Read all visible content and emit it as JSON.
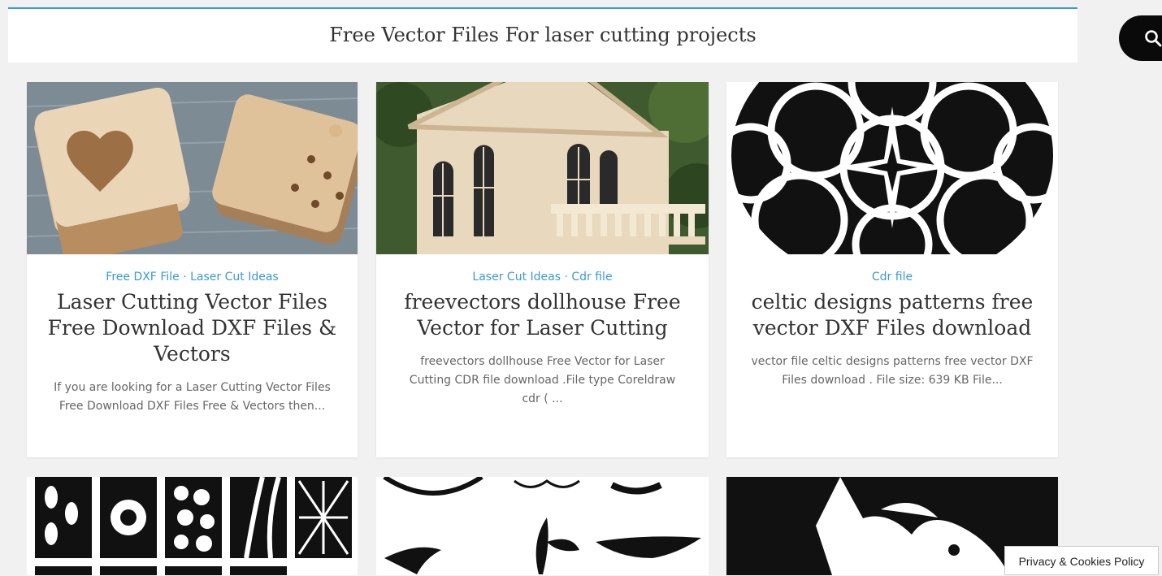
{
  "page": {
    "title": "Free Vector Files For laser cutting projects"
  },
  "cards": [
    {
      "categories": [
        "Free DXF File",
        "Laser Cut Ideas"
      ],
      "title": "Laser Cutting Vector Files Free Download DXF Files & Vectors",
      "excerpt": "If you are looking for a Laser Cutting Vector Files Free Download DXF Files Free & Vectors then...",
      "image": "wooden-boxes-photo"
    },
    {
      "categories": [
        "Laser Cut Ideas",
        "Cdr file"
      ],
      "title": "freevectors dollhouse Free Vector for Laser Cutting",
      "excerpt": "freevectors dollhouse Free Vector for Laser Cutting CDR file download .File type Coreldraw cdr ( ...",
      "image": "dollhouse-photo"
    },
    {
      "categories": [
        "Cdr file"
      ],
      "title": "celtic designs patterns free vector DXF Files download",
      "excerpt": "vector file celtic designs patterns free vector DXF Files download . File size: 639 KB File...",
      "image": "celtic-pattern"
    }
  ],
  "second_row": [
    {
      "image": "decorative-panels"
    },
    {
      "image": "ornament-set"
    },
    {
      "image": "face-stencil"
    }
  ],
  "category_separator": "·",
  "privacy_label": "Privacy & Cookies Policy",
  "colors": {
    "accent": "#3a99d8",
    "background": "#f1f1f1",
    "search": "#0a0a0a"
  },
  "icons": {
    "search": "search-icon"
  }
}
